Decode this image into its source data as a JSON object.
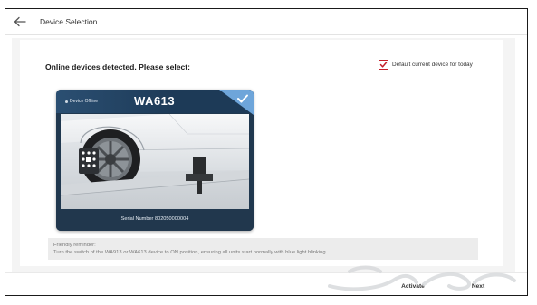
{
  "window": {
    "title": "Device Selection"
  },
  "icons": {
    "back": "back-arrow-icon",
    "check": "check-icon",
    "card_check": "check-icon",
    "status_dot": "dot-icon"
  },
  "main": {
    "heading": "Online devices detected. Please select:",
    "default_option": {
      "label": "Default current device for today",
      "checked": true
    }
  },
  "device_card": {
    "status": "Device Offline",
    "model": "WA613",
    "serial": "Serial Number 802050000004",
    "selected": true
  },
  "reminder": {
    "title": "Friendly reminder:",
    "text": "Turn the switch of the WA913 or WA613 device to ON position, ensuring all units start normally with blue light blinking."
  },
  "footer": {
    "activate": "Activate",
    "next": "Next"
  },
  "colors": {
    "accent_red": "#c4202a",
    "card_blue": "#1d3a57",
    "card_corner": "#6ea5da"
  }
}
